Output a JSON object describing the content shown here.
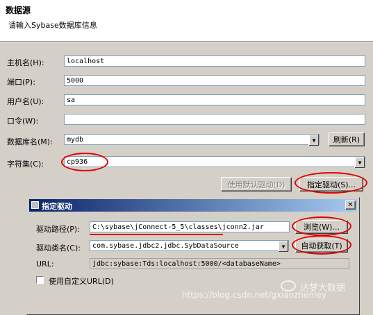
{
  "header": {
    "title": "数据源",
    "subtitle": "请输入Sybase数据库信息"
  },
  "form": {
    "host_label": "主机名(H):",
    "host_value": "localhost",
    "port_label": "端口(P):",
    "port_value": "5000",
    "user_label": "用户名(U):",
    "user_value": "sa",
    "password_label": "口令(W):",
    "password_value": "",
    "database_label": "数据库名(M):",
    "database_value": "mydb",
    "refresh_label": "刷新(R)",
    "charset_label": "字符集(C):",
    "charset_value": "cp936",
    "default_driver_label": "使用默认驱动(D)",
    "specify_driver_label": "指定驱动(S)..."
  },
  "dialog": {
    "title": "指定驱动",
    "close": "✕",
    "path_label": "驱动路径(P):",
    "path_value": "C:\\sybase\\jConnect-5_5\\classes\\jconn2.jar",
    "browse_label": "浏览(W)...",
    "class_label": "驱动类名(C):",
    "class_value": "com.sybase.jdbc2.jdbc.SybDataSource",
    "auto_label": "自动获取(T)",
    "url_label": "URL:",
    "url_value": "jdbc:sybase:Tds:localhost:5000/<databaseName>",
    "custom_url_label": "使用自定义URL(D)"
  },
  "watermark": {
    "brand": "达梦大数据",
    "url": "https://blog.csdn.net/gxiaozhenley"
  },
  "colors": {
    "annotation": "#e00000",
    "titlebar_start": "#0a246a",
    "titlebar_end": "#a6caf0"
  }
}
